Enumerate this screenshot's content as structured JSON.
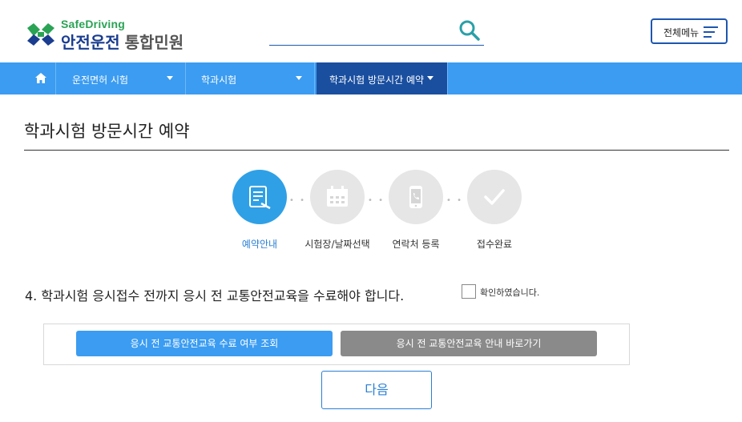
{
  "header": {
    "logo_sub": "SafeDriving",
    "logo_main": "안전운전",
    "logo_main2": "통합민원",
    "menu_label": "전체메뉴",
    "brand_blue": "#1a3d8f",
    "brand_green": "#2aa355"
  },
  "nav": {
    "items": [
      {
        "label": "운전면허 시험"
      },
      {
        "label": "학과시험"
      },
      {
        "label": "학과시험 방문시간 예약"
      }
    ],
    "bar_color": "#3b9cf2",
    "active_color": "#1a4fa0"
  },
  "page": {
    "title": "학과시험 방문시간 예약"
  },
  "steps": [
    {
      "label": "예약안내",
      "icon": "document-edit-icon",
      "active": true
    },
    {
      "label": "시험장/날짜선택",
      "icon": "calendar-icon",
      "active": false
    },
    {
      "label": "연락처 등록",
      "icon": "phone-icon",
      "active": false
    },
    {
      "label": "접수완료",
      "icon": "checkmark-icon",
      "active": false
    }
  ],
  "notice": {
    "text": "4. 학과시험 응시접수 전까지 응시 전 교통안전교육을 수료해야 합니다.",
    "confirm_label": "확인하였습니다.",
    "checked": false
  },
  "buttons": {
    "check_completion": "응시 전 교통안전교육 수료 여부 조회",
    "education_info": "응시 전 교통안전교육 안내 바로가기",
    "next": "다음"
  }
}
